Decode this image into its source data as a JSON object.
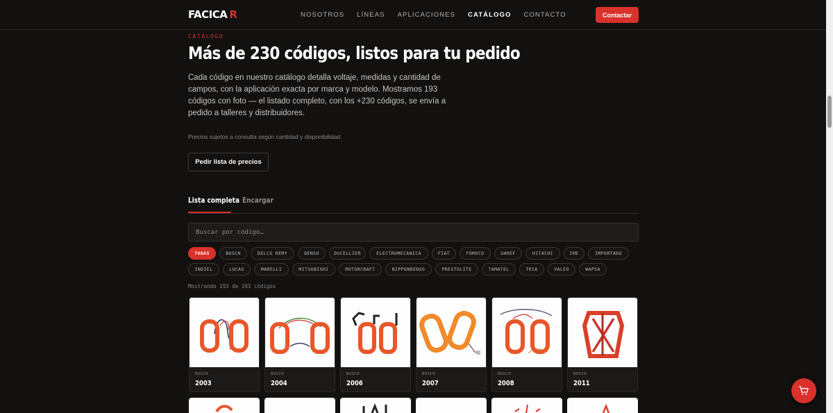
{
  "header": {
    "logo_main": "FACICA",
    "logo_accent": "R",
    "nav": [
      "NOSOTROS",
      "LÍNEAS",
      "APLICACIONES",
      "CATÁLOGO",
      "CONTACTO"
    ],
    "active_nav": "CATÁLOGO",
    "contact_button": "Contactar"
  },
  "hero": {
    "eyebrow": "CATÁLOGO",
    "title": "Más de 230 códigos, listos para tu pedido",
    "lead": "Cada código en nuestro catálogo detalla voltaje, medidas y cantidad de campos, con la aplicación exacta por marca y modelo. Mostramos 193 códigos con foto — el listado completo, con los +230 códigos, se envía a pedido a talleres y distribuidores.",
    "note": "Precios sujetos a consulta según cantidad y disponibilidad.",
    "price_button": "Pedir lista de precios"
  },
  "tabs": [
    "Lista completa",
    "Encargar"
  ],
  "search": {
    "placeholder": "Buscar por código…"
  },
  "filters": {
    "active": "TODAS",
    "row1": [
      "TODAS",
      "BOSCH",
      "DELCO REMY",
      "DENSO",
      "DUCELLIER",
      "ELECTROMECANICA",
      "FIAT",
      "FOMOCO",
      "GAREF",
      "HITACHI",
      "IME",
      "IMPORTADO"
    ],
    "row2": [
      "INDIEL",
      "LUCAS",
      "MARELLI",
      "MITSUBISHI",
      "MOTORCRAFT",
      "NIPPONDENSO",
      "PRESTOLITE",
      "TAMATEL",
      "TRIA",
      "VALEO",
      "WAPSA"
    ]
  },
  "results_text": "Mostrando 193 de 193 códigos",
  "products": [
    {
      "brand": "BOSCH",
      "code": "2003"
    },
    {
      "brand": "BOSCH",
      "code": "2004"
    },
    {
      "brand": "BOSCH",
      "code": "2006"
    },
    {
      "brand": "BOSCH",
      "code": "2007"
    },
    {
      "brand": "BOSCH",
      "code": "2008"
    },
    {
      "brand": "BOSCH",
      "code": "2011"
    }
  ],
  "colors": {
    "accent": "#d9312b",
    "background": "#121110",
    "coil_orange": "#e8562a"
  },
  "icons": {
    "cart": "cart-icon"
  }
}
